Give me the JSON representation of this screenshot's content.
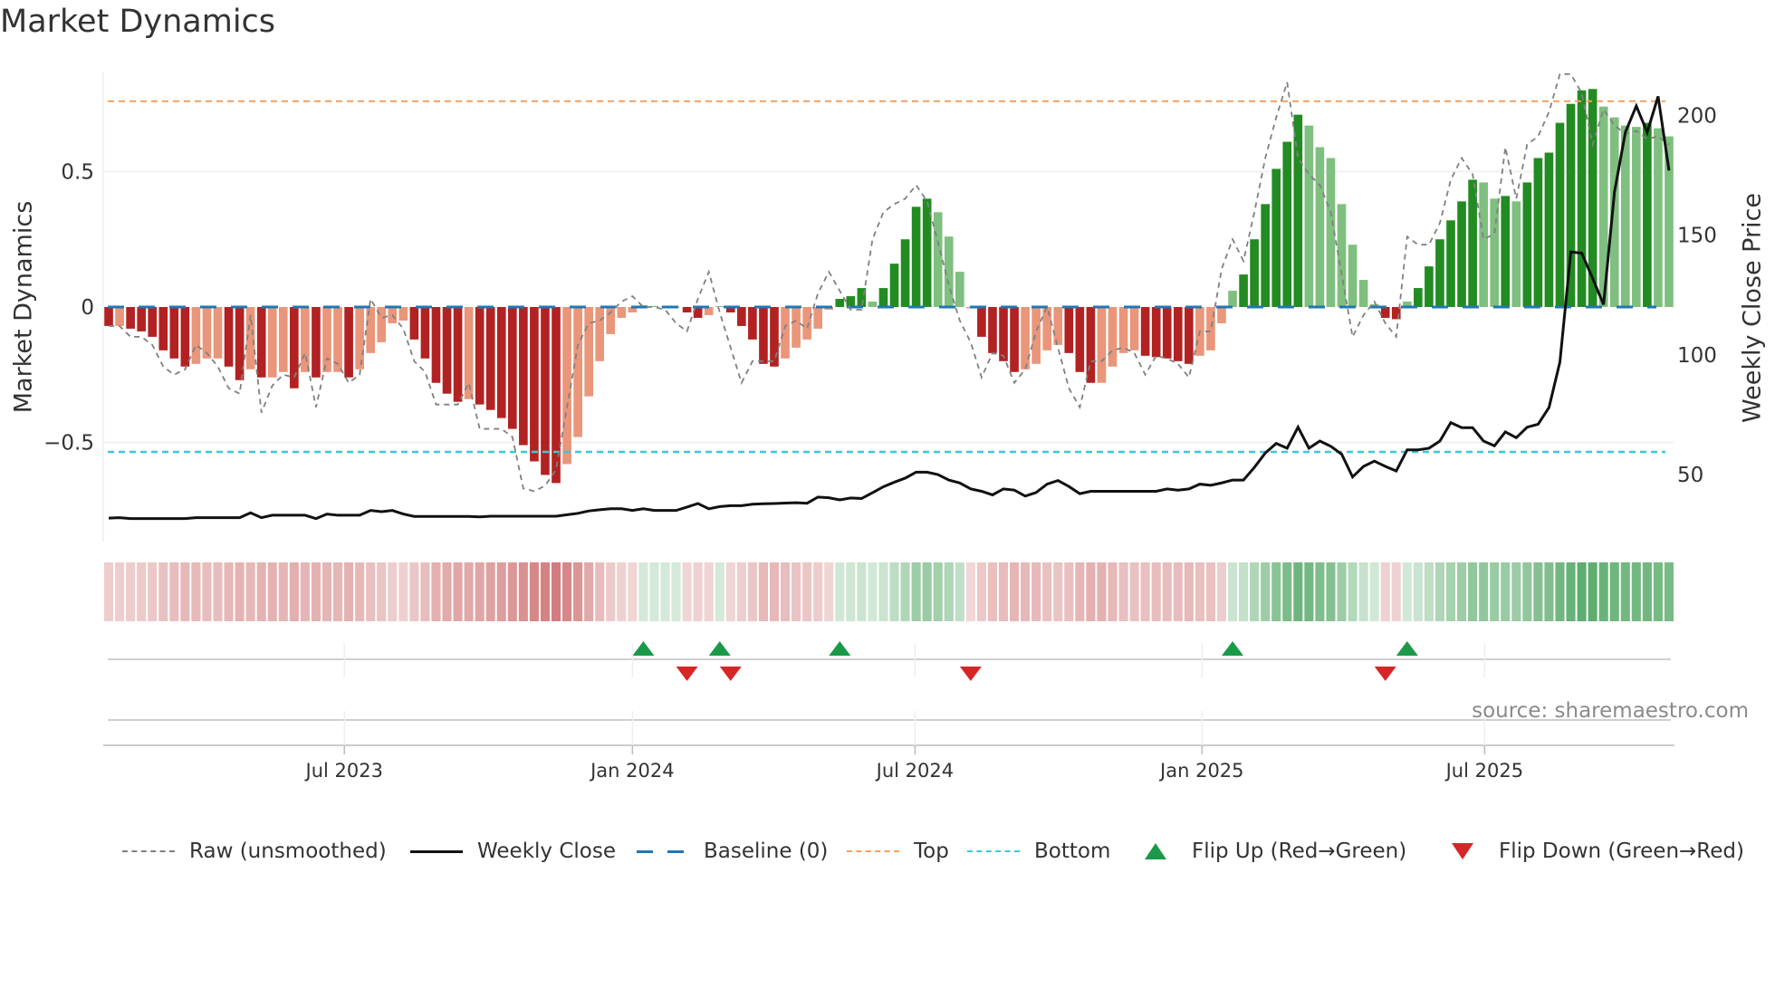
{
  "title": "Market Dynamics",
  "source": "source: sharemaestro.com",
  "legend": {
    "raw": "Raw (unsmoothed)",
    "close": "Weekly Close",
    "baseline": "Baseline (0)",
    "top": "Top",
    "bottom": "Bottom",
    "flip_up": "Flip Up (Red→Green)",
    "flip_down": "Flip Down (Green→Red)"
  },
  "colors": {
    "up_strong": "#228b22",
    "up_weak": "#7fbf7f",
    "down_strong": "#b22222",
    "down_weak": "#e9967a",
    "raw": "#808080",
    "close": "#111111",
    "baseline": "#1f77b4",
    "top": "#f0a060",
    "bottom": "#3cc8d8",
    "flip_up": "#1a9a48",
    "flip_down": "#d62728",
    "strip_up": "#3c9c50",
    "strip_down": "#c04848"
  },
  "chart_data": {
    "type": "bar",
    "title": "Market Dynamics",
    "ylabel": "Market Dynamics",
    "y2label": "Weekly Close Price",
    "ylim": [
      -0.866,
      0.866
    ],
    "y2lim": [
      22,
      218
    ],
    "yticks": [
      {
        "label": "0.5",
        "value": 0.5
      },
      {
        "label": "0",
        "value": 0
      },
      {
        "label": "−0.5",
        "value": -0.5
      }
    ],
    "y2ticks": [
      {
        "label": "50",
        "value": 50
      },
      {
        "label": "100",
        "value": 100
      },
      {
        "label": "150",
        "value": 150
      },
      {
        "label": "200",
        "value": 200
      }
    ],
    "x_ticks": [
      {
        "label": "Jul 2023",
        "index": 21.6
      },
      {
        "label": "Jan 2024",
        "index": 48.0
      },
      {
        "label": "Jul 2024",
        "index": 73.9
      },
      {
        "label": "Jan 2025",
        "index": 100.2
      },
      {
        "label": "Jul 2025",
        "index": 126.1
      }
    ],
    "grid": true,
    "legend_position": "bottom",
    "top_level": 0.76,
    "bottom_level": -0.535,
    "baseline": 0,
    "momentum": [
      -0.07,
      -0.07,
      -0.08,
      -0.09,
      -0.11,
      -0.16,
      -0.19,
      -0.22,
      -0.21,
      -0.19,
      -0.19,
      -0.22,
      -0.27,
      -0.23,
      -0.26,
      -0.26,
      -0.24,
      -0.3,
      -0.24,
      -0.26,
      -0.24,
      -0.24,
      -0.26,
      -0.23,
      -0.17,
      -0.13,
      -0.06,
      -0.05,
      -0.12,
      -0.19,
      -0.28,
      -0.32,
      -0.35,
      -0.34,
      -0.36,
      -0.38,
      -0.41,
      -0.45,
      -0.51,
      -0.57,
      -0.62,
      -0.65,
      -0.58,
      -0.48,
      -0.33,
      -0.2,
      -0.1,
      -0.04,
      -0.02,
      0.006,
      0.004,
      0.002,
      0.001,
      -0.02,
      -0.04,
      -0.03,
      0.003,
      -0.02,
      -0.07,
      -0.12,
      -0.21,
      -0.22,
      -0.19,
      -0.15,
      -0.12,
      -0.08,
      -0.01,
      0.03,
      0.04,
      0.07,
      0.02,
      0.07,
      0.16,
      0.25,
      0.37,
      0.4,
      0.35,
      0.26,
      0.13,
      -0.005,
      -0.11,
      -0.17,
      -0.2,
      -0.24,
      -0.23,
      -0.21,
      -0.16,
      -0.14,
      -0.17,
      -0.24,
      -0.28,
      -0.28,
      -0.22,
      -0.17,
      -0.16,
      -0.18,
      -0.185,
      -0.19,
      -0.2,
      -0.21,
      -0.18,
      -0.16,
      -0.06,
      0.06,
      0.12,
      0.25,
      0.38,
      0.51,
      0.61,
      0.71,
      0.67,
      0.59,
      0.55,
      0.38,
      0.23,
      0.1,
      0.01,
      -0.04,
      -0.045,
      0.02,
      0.07,
      0.15,
      0.25,
      0.32,
      0.39,
      0.47,
      0.46,
      0.4,
      0.41,
      0.39,
      0.46,
      0.55,
      0.57,
      0.68,
      0.75,
      0.8,
      0.805,
      0.74,
      0.7,
      0.67,
      0.665,
      0.68,
      0.66,
      0.63
    ],
    "raw": [
      -0.07,
      -0.07,
      -0.11,
      -0.11,
      -0.14,
      -0.22,
      -0.25,
      -0.23,
      -0.14,
      -0.17,
      -0.22,
      -0.3,
      -0.32,
      -0.03,
      -0.39,
      -0.29,
      -0.25,
      -0.26,
      -0.17,
      -0.37,
      -0.19,
      -0.21,
      -0.28,
      -0.25,
      0.03,
      -0.04,
      -0.03,
      -0.08,
      -0.2,
      -0.24,
      -0.36,
      -0.36,
      -0.36,
      -0.28,
      -0.45,
      -0.45,
      -0.45,
      -0.48,
      -0.67,
      -0.68,
      -0.66,
      -0.6,
      -0.37,
      -0.14,
      -0.06,
      -0.05,
      -0.02,
      0.02,
      0.04,
      0.0,
      0.0,
      -0.01,
      -0.06,
      -0.09,
      0.03,
      0.13,
      -0.02,
      -0.15,
      -0.28,
      -0.2,
      -0.2,
      -0.2,
      -0.07,
      -0.05,
      -0.08,
      0.05,
      0.13,
      0.06,
      -0.01,
      -0.01,
      0.25,
      0.35,
      0.38,
      0.4,
      0.45,
      0.39,
      0.24,
      0.08,
      -0.05,
      -0.13,
      -0.26,
      -0.17,
      -0.18,
      -0.28,
      -0.23,
      -0.09,
      0.0,
      -0.15,
      -0.3,
      -0.37,
      -0.2,
      -0.2,
      -0.16,
      -0.15,
      -0.17,
      -0.25,
      -0.18,
      -0.19,
      -0.21,
      -0.26,
      -0.09,
      -0.09,
      0.14,
      0.25,
      0.17,
      0.35,
      0.55,
      0.7,
      0.83,
      0.55,
      0.49,
      0.45,
      0.35,
      0.12,
      -0.11,
      -0.03,
      0.02,
      -0.06,
      -0.11,
      0.26,
      0.23,
      0.23,
      0.31,
      0.47,
      0.55,
      0.49,
      0.25,
      0.27,
      0.59,
      0.4,
      0.6,
      0.63,
      0.72,
      0.86,
      0.86,
      0.79,
      0.6,
      0.73,
      0.67,
      0.64,
      0.65,
      0.62,
      0.63,
      0.6
    ],
    "weekly_close": [
      31.8,
      32,
      31.6,
      31.6,
      31.6,
      31.6,
      31.6,
      31.6,
      32,
      32,
      32,
      32,
      32,
      34,
      32,
      33,
      33,
      33,
      33,
      31.6,
      33.5,
      33,
      33,
      33,
      35,
      34.5,
      35,
      33.5,
      32.5,
      32.5,
      32.5,
      32.5,
      32.5,
      32.5,
      32.3,
      32.6,
      32.6,
      32.6,
      32.6,
      32.6,
      32.6,
      32.6,
      33.2,
      33.8,
      34.8,
      35.3,
      35.7,
      35.7,
      35,
      35.7,
      35,
      35,
      35,
      36.4,
      37.9,
      35.7,
      36.6,
      37,
      37,
      37.6,
      37.8,
      37.9,
      38.1,
      38.2,
      38,
      40.6,
      40.3,
      39.4,
      40.2,
      40,
      42.4,
      44.9,
      46.8,
      48.5,
      51,
      51,
      50,
      47.7,
      46.5,
      44,
      43,
      41.5,
      44,
      43.5,
      41,
      42.5,
      46,
      47.5,
      45,
      42,
      43,
      43,
      43,
      43,
      43,
      43,
      43,
      44,
      43.5,
      44,
      46,
      45.5,
      46.5,
      47.7,
      47.7,
      53,
      59,
      63,
      61,
      69.8,
      61,
      64,
      61.8,
      58.5,
      49,
      53.4,
      55.6,
      53.4,
      51.5,
      60.3,
      60.3,
      61,
      64,
      71.7,
      69.6,
      69.6,
      64,
      62,
      67.8,
      65.4,
      69.8,
      71,
      78,
      97,
      143,
      142.5,
      132,
      121,
      168,
      193,
      204,
      193,
      208,
      177
    ],
    "flips_up": [
      49,
      56,
      67,
      103,
      119
    ],
    "flips_down": [
      53,
      57,
      79,
      117
    ],
    "initial_regime": "down"
  }
}
